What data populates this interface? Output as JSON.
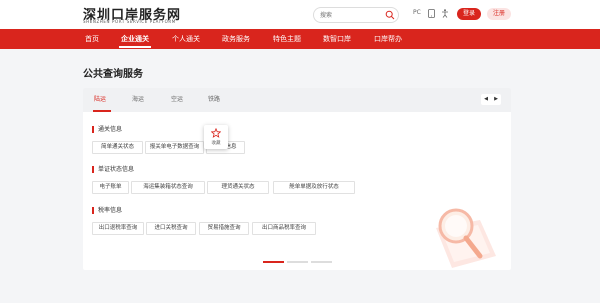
{
  "header": {
    "logo_title": "深圳口岸服务网",
    "logo_subtitle": "SHENZHEN PORT SERVICE PLATFORM",
    "search_placeholder": "搜索",
    "icons": [
      "PC",
      "mobile-icon",
      "accessibility-icon"
    ],
    "icon_text_pc": "PC",
    "login_label": "登录",
    "register_label": "注册"
  },
  "nav": {
    "items": [
      "首页",
      "企业通关",
      "个人通关",
      "政务服务",
      "特色主题",
      "数智口岸",
      "口岸帮办"
    ],
    "active_index": 1
  },
  "main": {
    "title": "公共查询服务",
    "tabs": [
      "陆运",
      "海运",
      "空运",
      "铁路"
    ],
    "active_tab": 0,
    "sections": [
      {
        "title": "通关信息",
        "items": [
          "简单通关状态",
          "报关单电子数据查询",
          "口岸信息"
        ]
      },
      {
        "title": "单证状态信息",
        "items": [
          "电子账单",
          "海运集装箱状态查询",
          "理货通关状态",
          "舱单单据及放行状态"
        ]
      },
      {
        "title": "税率信息",
        "items": [
          "出口退税率查询",
          "进口关税查询",
          "贸易措施查询",
          "出口商品税率查询"
        ]
      }
    ],
    "favorite_popup_label": "收藏",
    "pager_count": 3,
    "pager_active": 0
  },
  "colors": {
    "brand": "#d9251d"
  }
}
